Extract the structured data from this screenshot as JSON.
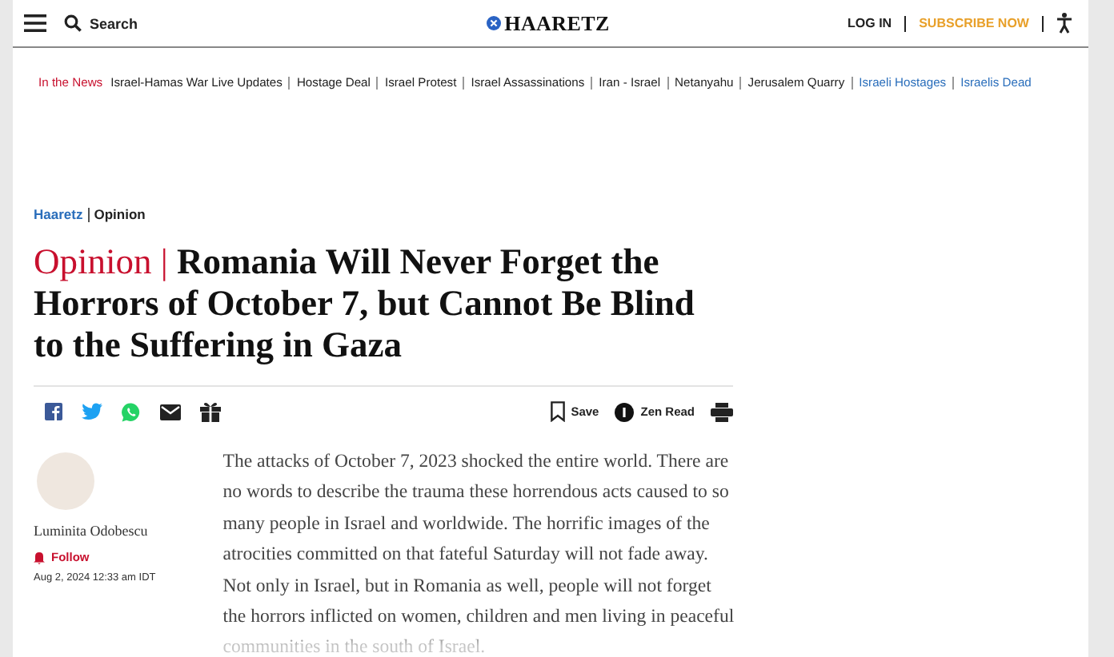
{
  "header": {
    "search_label": "Search",
    "logo": "HAARETZ",
    "login": "LOG IN",
    "subscribe": "SUBSCRIBE NOW"
  },
  "news_bar": {
    "label": "In the News",
    "links": [
      {
        "text": "Israel-Hamas War Live Updates",
        "kind": "plain"
      },
      {
        "text": "Hostage Deal",
        "kind": "plain"
      },
      {
        "text": "Israel Protest",
        "kind": "plain"
      },
      {
        "text": "Israel Assassinations",
        "kind": "plain"
      },
      {
        "text": "Iran - Israel",
        "kind": "plain"
      },
      {
        "text": "Netanyahu",
        "kind": "plain"
      },
      {
        "text": "Jerusalem Quarry",
        "kind": "plain"
      },
      {
        "text": "Israeli Hostages",
        "kind": "promoted"
      },
      {
        "text": "Israelis Dead",
        "kind": "promoted"
      }
    ]
  },
  "breadcrumb": [
    "Haaretz",
    "Opinion"
  ],
  "article": {
    "section": "Opinion |",
    "title": "Romania Will Never Forget the Horrors of October 7, but Cannot Be Blind to the Suffering in Gaza",
    "actions": {
      "save": "Save",
      "zen_read": "Zen Read"
    },
    "author": {
      "name": "Luminita Odobescu",
      "follow": "Follow",
      "date": "Aug 2, 2024 12:33 am IDT"
    },
    "body": "The attacks of October 7, 2023 shocked the entire world. There are no words to describe the trauma these horrendous acts caused to so many people in Israel and worldwide. The horrific images of the atrocities committed on that fateful Saturday will not fade away. Not only in Israel, but in Romania as well, people will not forget the horrors inflicted on women, children and men living in peaceful communities in the south of Israel."
  }
}
